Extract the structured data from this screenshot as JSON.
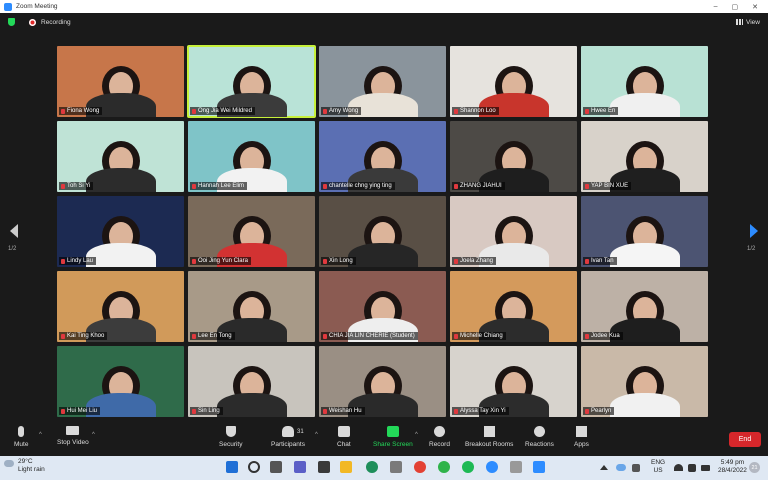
{
  "window": {
    "title": "Zoom Meeting"
  },
  "topbar": {
    "recording_label": "Recording",
    "view_label": "View"
  },
  "gallery": {
    "page_left": "1/2",
    "page_right": "1/2",
    "participants": [
      {
        "name": "Fiona Wong",
        "bg": "#c7764a",
        "shirt": "#2b2b2b"
      },
      {
        "name": "Ong Jia Wei Mildred",
        "bg": "#b9e3d7",
        "shirt": "#3b3b3b",
        "active": true
      },
      {
        "name": "Amy Wong",
        "bg": "#8a949c",
        "shirt": "#e8e2d8"
      },
      {
        "name": "Shannon Loo",
        "bg": "#e6e3de",
        "shirt": "#c8352c"
      },
      {
        "name": "Hwee En",
        "bg": "#b8e1d4",
        "shirt": "#f0f0f0"
      },
      {
        "name": "Toh Si Yi",
        "bg": "#bfe3d6",
        "shirt": "#2c2c2c"
      },
      {
        "name": "Hannah Lee Elim",
        "bg": "#7fc4c8",
        "shirt": "#f2f2f2"
      },
      {
        "name": "chantelle chng ying ting",
        "bg": "#5b6fb3",
        "shirt": "#3a3a3a"
      },
      {
        "name": "ZHANG JIAHUI",
        "bg": "#4d4a46",
        "shirt": "#1e1e1e"
      },
      {
        "name": "YAP BIN XUE",
        "bg": "#d8d2ca",
        "shirt": "#1f1f1f"
      },
      {
        "name": "Lindy Lau",
        "bg": "#1c2a52",
        "shirt": "#f2f2f2"
      },
      {
        "name": "Ooi Jing Yun Clara",
        "bg": "#7a6a5a",
        "shirt": "#d23232"
      },
      {
        "name": "Xin Long",
        "bg": "#594f45",
        "shirt": "#262626"
      },
      {
        "name": "Joela Zhang",
        "bg": "#d8c9c2",
        "shirt": "#e9e9e9"
      },
      {
        "name": "Ivan Tan",
        "bg": "#4c5472",
        "shirt": "#f5f5f5"
      },
      {
        "name": "Kai Ting Khoo",
        "bg": "#d19a5a",
        "shirt": "#3c3c3c"
      },
      {
        "name": "Lee En Tong",
        "bg": "#a89a88",
        "shirt": "#2a2a2a"
      },
      {
        "name": "CHIA JIA LIN CHERIE (Student)",
        "bg": "#8b5b52",
        "shirt": "#eeeeee"
      },
      {
        "name": "Michelle Chiang",
        "bg": "#d49a5c",
        "shirt": "#2c2c2c"
      },
      {
        "name": "Jodee Kua",
        "bg": "#bdb1a6",
        "shirt": "#1e1e1e"
      },
      {
        "name": "Hui Mei Liu",
        "bg": "#2f6b4a",
        "shirt": "#3f6aa8"
      },
      {
        "name": "Sin Ling",
        "bg": "#c8c4bd",
        "shirt": "#2b2b2b"
      },
      {
        "name": "Weishan Hu",
        "bg": "#9a8f84",
        "shirt": "#2a2a2a"
      },
      {
        "name": "Alyssa Tay Xin Yi",
        "bg": "#d7d3cd",
        "shirt": "#2c2c2c"
      },
      {
        "name": "Pearlyn",
        "bg": "#c9b9a8",
        "shirt": "#f1f1f1"
      }
    ]
  },
  "toolbar": {
    "mute": "Mute",
    "stop_video": "Stop Video",
    "security": "Security",
    "participants": "Participants",
    "participants_count": "31",
    "chat": "Chat",
    "share_screen": "Share Screen",
    "record": "Record",
    "breakout_rooms": "Breakout Rooms",
    "reactions": "Reactions",
    "apps": "Apps",
    "end": "End"
  },
  "taskbar": {
    "weather_temp": "29°C",
    "weather_desc": "Light rain",
    "lang_line1": "ENG",
    "lang_line2": "US",
    "time": "5:49 pm",
    "date": "28/4/2022",
    "notification_count": "21"
  },
  "colors": {
    "accent": "#2d8cff",
    "share": "#23d959",
    "end": "#d6272b",
    "active_speaker": "#c6f03a"
  }
}
